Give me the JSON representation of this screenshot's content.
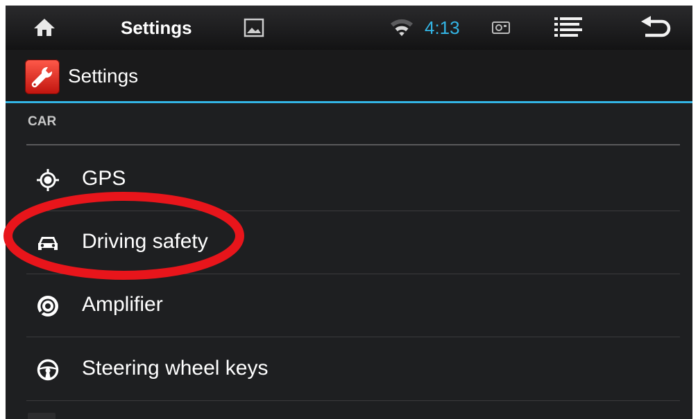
{
  "status_bar": {
    "title": "Settings",
    "time": "4:13",
    "icons": [
      "home-icon",
      "gallery-icon",
      "wifi-icon",
      "sim-card-icon",
      "notifications-list-icon",
      "back-icon"
    ],
    "time_color": "#33b5e5"
  },
  "action_bar": {
    "title": "Settings",
    "icon": "settings-wrench-icon",
    "accent_color": "#33b5e5"
  },
  "section": {
    "header": "CAR"
  },
  "items": [
    {
      "label": "GPS",
      "icon": "gps-crosshair-icon"
    },
    {
      "label": "Driving safety",
      "icon": "car-icon",
      "highlighted": true
    },
    {
      "label": "Amplifier",
      "icon": "speaker-icon"
    },
    {
      "label": "Steering wheel keys",
      "icon": "steering-wheel-icon"
    }
  ],
  "highlight": {
    "target": "Driving safety",
    "color": "#e8151b"
  }
}
